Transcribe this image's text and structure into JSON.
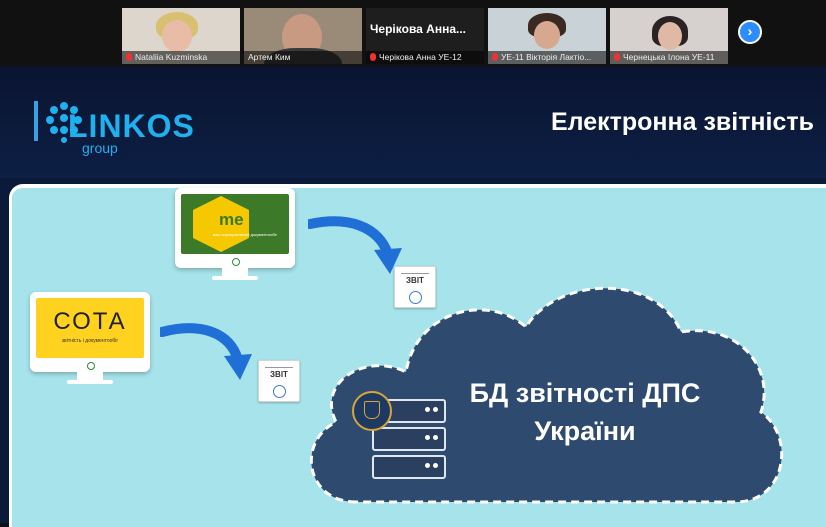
{
  "participants": [
    {
      "name": "Nataliia Kuzminska"
    },
    {
      "name": "Артем Ким"
    },
    {
      "name": "Черікова Анна УЕ-12",
      "display_name": "Черікова  Анна..."
    },
    {
      "name": "УЕ-11 Вікторія Лактіо..."
    },
    {
      "name": "Чернецька Ілона УЕ-11"
    }
  ],
  "next_icon": "chevron-right-icon",
  "slide": {
    "logo_main": "LINKOS",
    "logo_sub": "group",
    "title": "Електронна звітність",
    "medoc_label": "me doc",
    "medoc_sub": "ваш корпоративний документообіг",
    "sota_label": "СОТА",
    "sota_sub": "звітність і документообіг",
    "doc1_label": "ЗВІТ",
    "doc2_label": "ЗВІТ",
    "cloud_line1": "БД звітності ДПС",
    "cloud_line2": "України"
  },
  "colors": {
    "accent": "#2d8cff",
    "panel_bg": "#a6e3ea",
    "cloud": "#2e4a6e",
    "medoc_green": "#3c7a2a",
    "medoc_yellow": "#f5c800",
    "sota_yellow": "#ffd21f"
  }
}
